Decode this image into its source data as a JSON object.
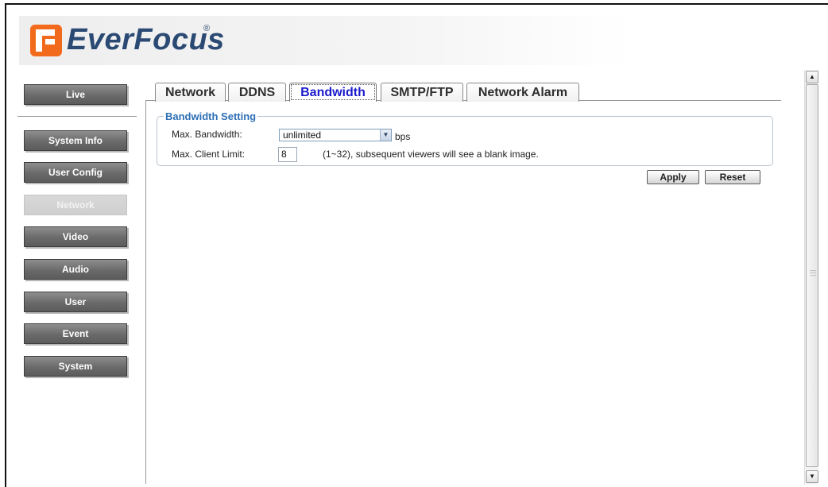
{
  "brand": {
    "name": "EverFocus",
    "registered": "®",
    "mark_color": "#f26a1b",
    "text_color": "#2b4a73"
  },
  "nav": {
    "items": [
      {
        "id": "live",
        "label": "Live",
        "active": false
      },
      {
        "id": "system-info",
        "label": "System Info",
        "active": false
      },
      {
        "id": "user-config",
        "label": "User Config",
        "active": false
      },
      {
        "id": "network",
        "label": "Network",
        "active": true
      },
      {
        "id": "video",
        "label": "Video",
        "active": false
      },
      {
        "id": "audio",
        "label": "Audio",
        "active": false
      },
      {
        "id": "user",
        "label": "User",
        "active": false
      },
      {
        "id": "event",
        "label": "Event",
        "active": false
      },
      {
        "id": "system",
        "label": "System",
        "active": false
      }
    ]
  },
  "tabs": [
    {
      "id": "network",
      "label": "Network",
      "active": false
    },
    {
      "id": "ddns",
      "label": "DDNS",
      "active": false
    },
    {
      "id": "bandwidth",
      "label": "Bandwidth",
      "active": true
    },
    {
      "id": "smtp-ftp",
      "label": "SMTP/FTP",
      "active": false
    },
    {
      "id": "network-alarm",
      "label": "Network Alarm",
      "active": false
    }
  ],
  "bandwidth": {
    "legend": "Bandwidth Setting",
    "max_bandwidth_label": "Max. Bandwidth:",
    "max_bandwidth_value": "unlimited",
    "max_bandwidth_unit": "bps",
    "max_client_label": "Max. Client Limit:",
    "max_client_value": "8",
    "max_client_hint": "(1~32), subsequent viewers will see a blank image."
  },
  "actions": {
    "apply": "Apply",
    "reset": "Reset"
  },
  "colors": {
    "active_tab_text": "#1a1acc",
    "legend": "#2d6fb5",
    "nav_button": "#6a6a6a"
  }
}
